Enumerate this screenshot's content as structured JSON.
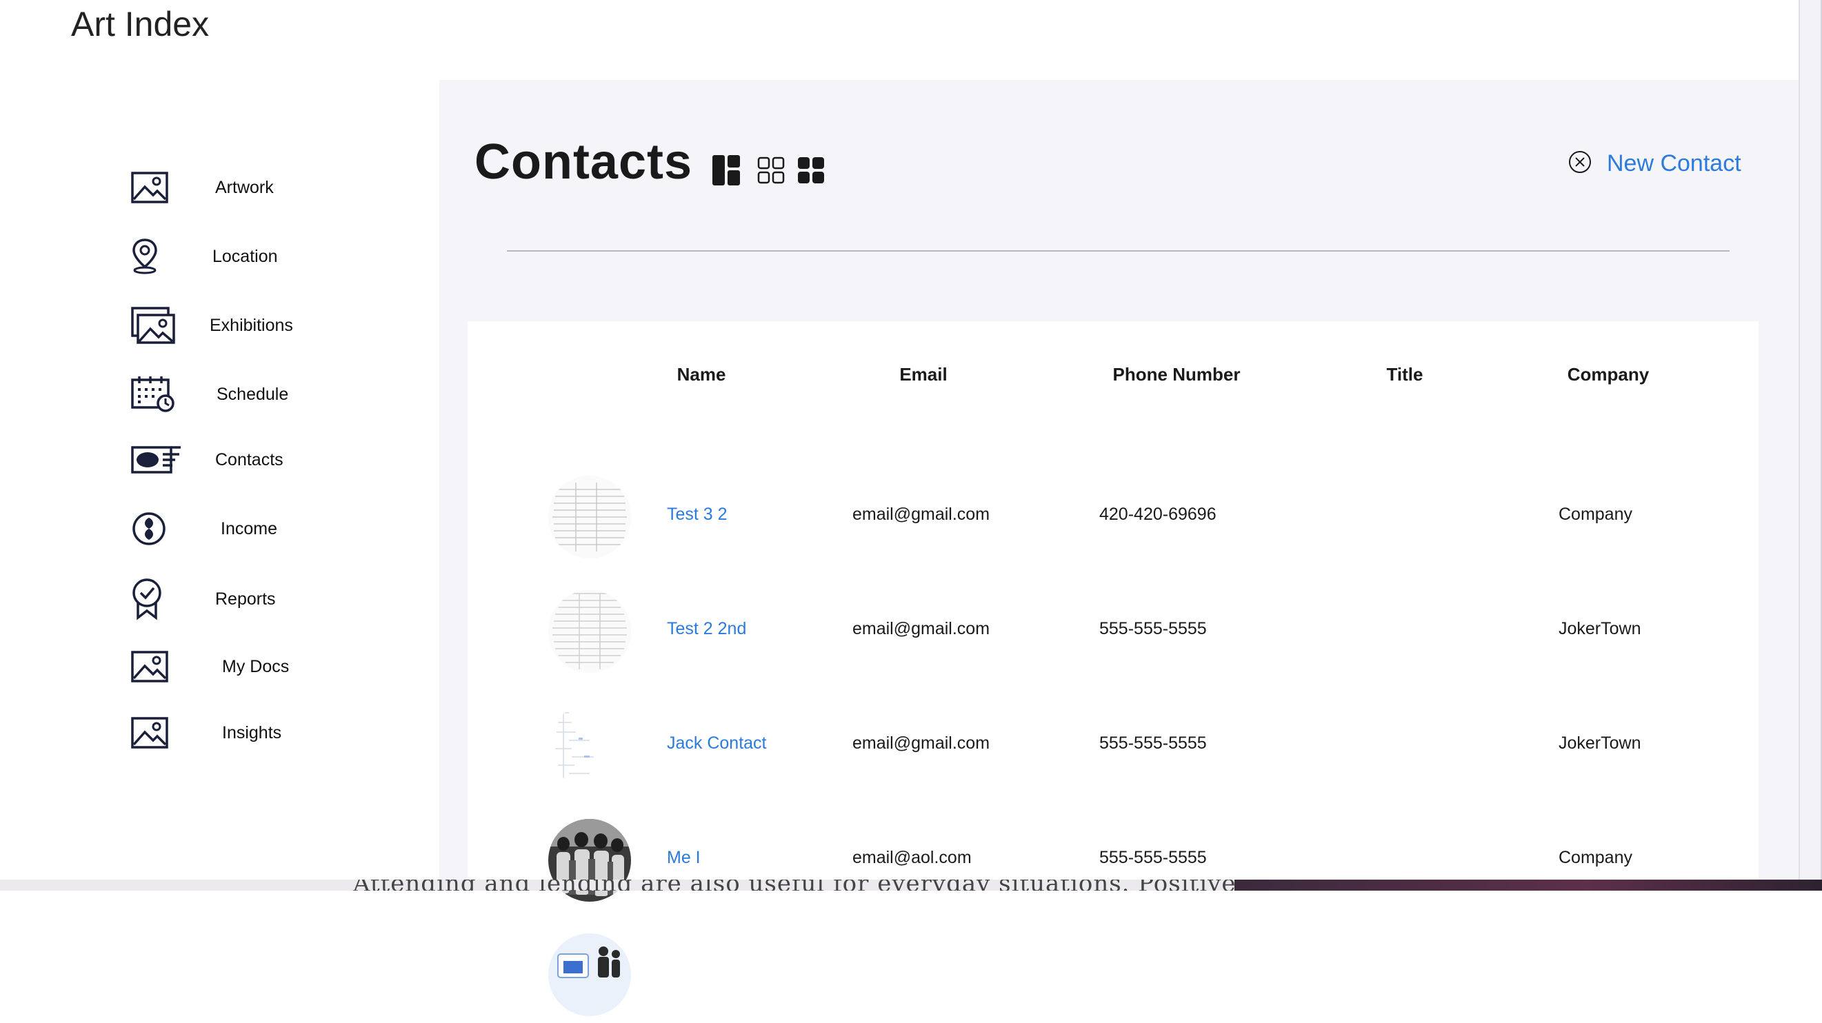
{
  "app": {
    "title": "Art Index"
  },
  "sidebar": {
    "items": [
      {
        "label": "Artwork",
        "icon": "image-icon"
      },
      {
        "label": "Location",
        "icon": "map-pin-icon"
      },
      {
        "label": "Exhibitions",
        "icon": "gallery-images-icon"
      },
      {
        "label": "Schedule",
        "icon": "calendar-clock-icon"
      },
      {
        "label": "Contacts",
        "icon": "contact-card-icon"
      },
      {
        "label": "Income",
        "icon": "money-icon"
      },
      {
        "label": "Reports",
        "icon": "award-badge-icon"
      },
      {
        "label": "My Docs",
        "icon": "image-icon"
      },
      {
        "label": "Insights",
        "icon": "image-icon"
      }
    ]
  },
  "main": {
    "title": "Contacts",
    "view_modes": [
      "layout-icon",
      "grid-outline-icon",
      "grid-filled-icon"
    ],
    "new_contact_label": "New Contact"
  },
  "table": {
    "headers": {
      "name": "Name",
      "email": "Email",
      "phone": "Phone Number",
      "title": "Title",
      "company": "Company"
    },
    "rows": [
      {
        "name": "Test 3 2",
        "email": "email@gmail.com",
        "phone": "420-420-69696",
        "title": "",
        "company": "Company"
      },
      {
        "name": "Test 2 2nd",
        "email": "email@gmail.com",
        "phone": "555-555-5555",
        "title": "",
        "company": "JokerTown"
      },
      {
        "name": "Jack Contact",
        "email": "email@gmail.com",
        "phone": "555-555-5555",
        "title": "",
        "company": "JokerTown"
      },
      {
        "name": "Me I",
        "email": "email@aol.com",
        "phone": "555-555-5555",
        "title": "",
        "company": "Company"
      }
    ]
  },
  "background": {
    "text": "Attending and lending are also useful for everyday situations. Positive be-"
  },
  "colors": {
    "accent": "#2b7bde",
    "icon": "#1a1f3a",
    "panel": "#f5f5f9"
  }
}
